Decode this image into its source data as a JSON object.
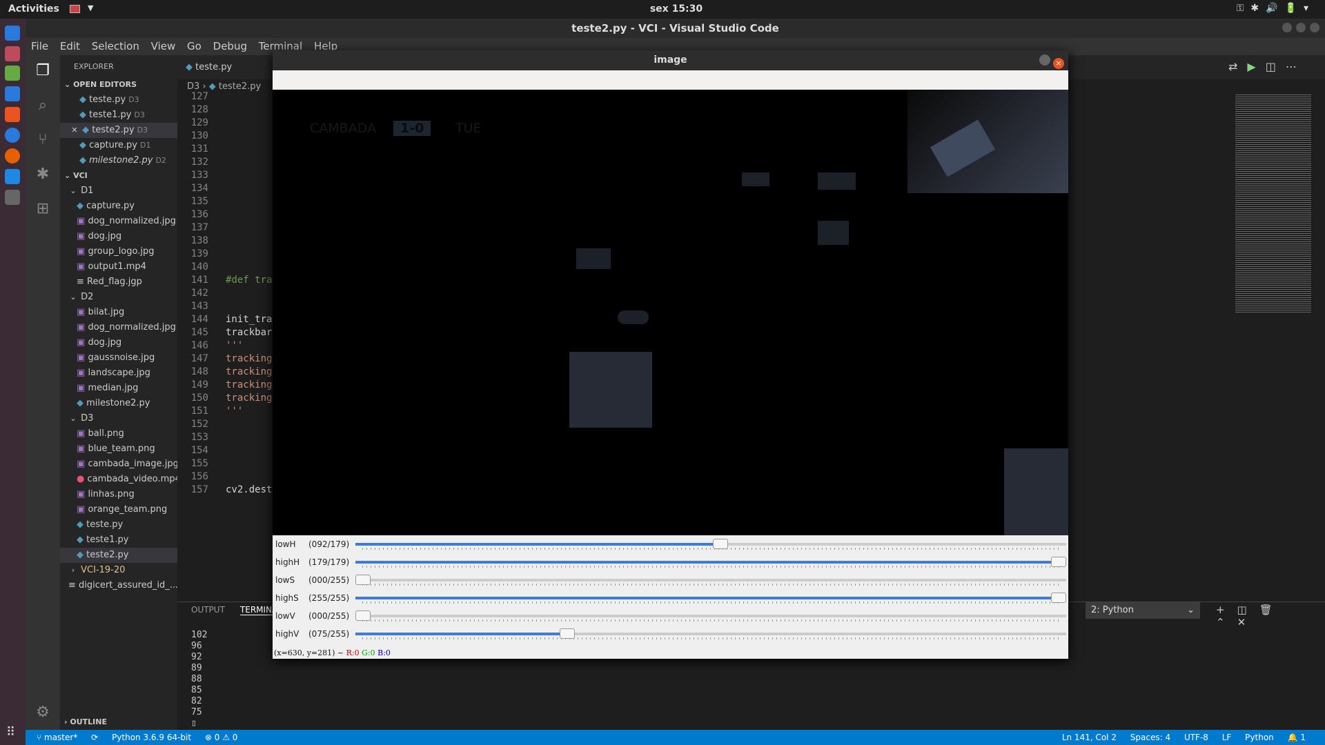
{
  "topbar": {
    "activities": "Activities",
    "clock": "sex 15:30"
  },
  "window": {
    "title": "teste2.py - VCI - Visual Studio Code"
  },
  "menu": [
    "File",
    "Edit",
    "Selection",
    "View",
    "Go",
    "Debug",
    "Terminal",
    "Help"
  ],
  "explorer": {
    "header": "EXPLORER",
    "open_editors_label": "OPEN EDITORS",
    "open_editors": [
      {
        "name": "teste.py",
        "dir": "D3"
      },
      {
        "name": "teste1.py",
        "dir": "D3"
      },
      {
        "name": "teste2.py",
        "dir": "D3"
      },
      {
        "name": "capture.py",
        "dir": "D1"
      },
      {
        "name": "milestone2.py",
        "dir": "D2"
      }
    ],
    "root": "VCI",
    "d1": "D1",
    "d1_files": [
      "capture.py",
      "dog_normalized.jpg",
      "dog.jpg",
      "group_logo.jpg",
      "output1.mp4",
      "Red_flag.jgp"
    ],
    "d2": "D2",
    "d2_files": [
      "bilat.jpg",
      "dog_normalized.jpg",
      "dog.jpg",
      "gaussnoise.jpg",
      "landscape.jpg",
      "median.jpg",
      "milestone2.py"
    ],
    "d3": "D3",
    "d3_files": [
      "ball.png",
      "blue_team.png",
      "cambada_image.jpg",
      "cambada_video.mp4",
      "linhas.png",
      "orange_team.png",
      "teste.py",
      "teste1.py",
      "teste2.py"
    ],
    "other": [
      "VCI-19-20",
      "digicert_assured_id_..."
    ],
    "outline": "OUTLINE"
  },
  "tabs": [
    "teste.py"
  ],
  "breadcrumb": {
    "dir": "D3",
    "file": "teste2.py"
  },
  "editor": {
    "lines": [
      "127",
      "128",
      "129",
      "130",
      "131",
      "132",
      "133",
      "134",
      "135",
      "136",
      "137",
      "138",
      "139",
      "140",
      "141",
      "142",
      "143",
      "144",
      "145",
      "146",
      "147",
      "148",
      "149",
      "150",
      "151",
      "152",
      "153",
      "154",
      "155",
      "156",
      "157"
    ],
    "code": {
      "141": "#def tra",
      "144": "init_tra",
      "145": "trackbar",
      "146": "'''",
      "147": "tracking",
      "148": "tracking",
      "149": "tracking",
      "150": "tracking",
      "151": "'''",
      "157": "cv2.dest"
    }
  },
  "panel": {
    "output": "OUTPUT",
    "terminal": "TERMINAL",
    "shell": "2: Python",
    "terminal_lines": "102\n96\n92\n89\n88\n85\n82\n75\n▯"
  },
  "statusbar": {
    "branch": "master*",
    "python": "Python 3.6.9 64-bit",
    "problems": "⊗ 0 ⚠ 0",
    "position": "Ln 141, Col 2",
    "spaces": "Spaces: 4",
    "encoding": "UTF-8",
    "eol": "LF",
    "language": "Python",
    "bell": "🔔 1"
  },
  "cv": {
    "title": "image",
    "score": {
      "left": "CAMBADA",
      "mid": "1-0",
      "right": "TUE"
    },
    "trackbars": [
      {
        "name": "lowH",
        "value": "(092/179)",
        "frac": 0.514
      },
      {
        "name": "highH",
        "value": "(179/179)",
        "frac": 1.0
      },
      {
        "name": "lowS",
        "value": "(000/255)",
        "frac": 0.0
      },
      {
        "name": "highS",
        "value": "(255/255)",
        "frac": 1.0
      },
      {
        "name": "lowV",
        "value": "(000/255)",
        "frac": 0.0
      },
      {
        "name": "highV",
        "value": "(075/255)",
        "frac": 0.294
      }
    ],
    "status": {
      "xy": "(x=630, y=281) ~",
      "r": "R:0",
      "g": "G:0",
      "b": "B:0"
    }
  }
}
